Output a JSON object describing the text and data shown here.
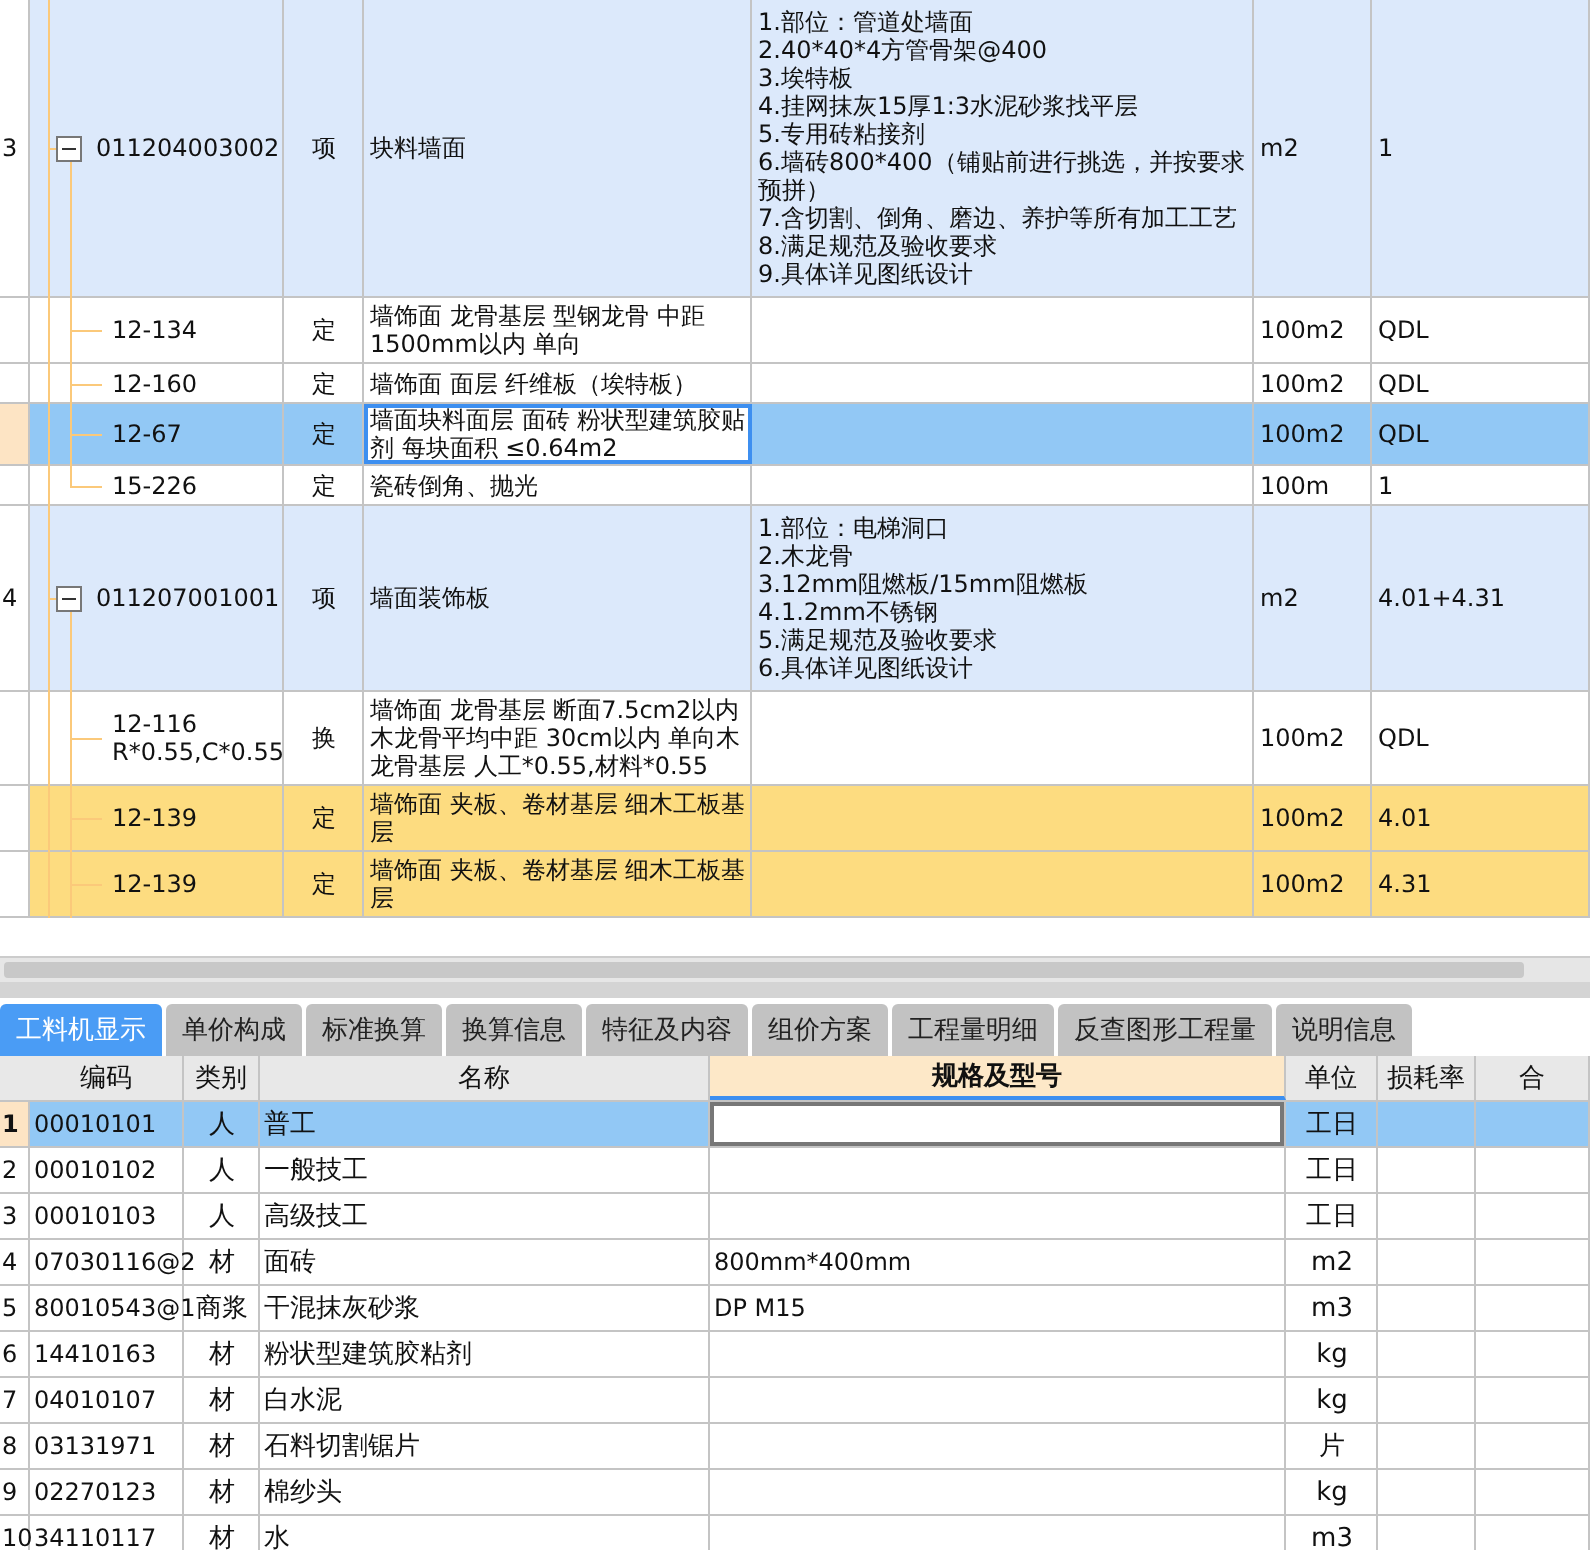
{
  "upper_table": {
    "rows": [
      {
        "row_number": "3",
        "code": "011204003002",
        "type": "项",
        "name": "块料墙面",
        "features": "1.部位：管道处墙面\n2.40*40*4方管骨架@400\n3.埃特板\n4.挂网抹灰15厚1:3水泥砂浆找平层\n5.专用砖粘接剂\n6.墙砖800*400（铺贴前进行挑选，并按要求预拼）\n7.含切割、倒角、磨边、养护等所有加工工艺\n8.满足规范及验收要求\n9.具体详见图纸设计",
        "unit": "m2",
        "quantity": "1",
        "expanded": true,
        "selected": false,
        "highlighted": false,
        "children": [
          {
            "code": "12-134",
            "type": "定",
            "name": "墙饰面 龙骨基层 型钢龙骨 中距1500mm以内 单向",
            "unit": "100m2",
            "quantity": "QDL",
            "selected": false,
            "highlighted": false
          },
          {
            "code": "12-160",
            "type": "定",
            "name": "墙饰面 面层 纤维板（埃特板）",
            "unit": "100m2",
            "quantity": "QDL",
            "selected": false,
            "highlighted": false
          },
          {
            "code": "12-67",
            "type": "定",
            "name": "墙面块料面层 面砖 粉状型建筑胶贴剂 每块面积 ≤0.64m2",
            "unit": "100m2",
            "quantity": "QDL",
            "selected": true,
            "highlighted": false
          },
          {
            "code": "15-226",
            "type": "定",
            "name": "瓷砖倒角、抛光",
            "unit": "100m",
            "quantity": "1",
            "selected": false,
            "highlighted": false
          }
        ]
      },
      {
        "row_number": "4",
        "code": "011207001001",
        "type": "项",
        "name": "墙面装饰板",
        "features": "1.部位：电梯洞口\n2.木龙骨\n3.12mm阻燃板/15mm阻燃板\n4.1.2mm不锈钢\n5.满足规范及验收要求\n6.具体详见图纸设计",
        "unit": "m2",
        "quantity": "4.01+4.31",
        "expanded": true,
        "selected": false,
        "highlighted": false,
        "children": [
          {
            "code": "12-116\nR*0.55,C*0.55",
            "type": "换",
            "name": "墙饰面 龙骨基层 断面7.5cm2以内木龙骨平均中距 30cm以内 单向木龙骨基层 人工*0.55,材料*0.55",
            "unit": "100m2",
            "quantity": "QDL",
            "selected": false,
            "highlighted": false
          },
          {
            "code": "12-139",
            "type": "定",
            "name": "墙饰面 夹板、卷材基层 细木工板基层",
            "unit": "100m2",
            "quantity": "4.01",
            "selected": false,
            "highlighted": true
          },
          {
            "code": "12-139",
            "type": "定",
            "name": "墙饰面 夹板、卷材基层 细木工板基层",
            "unit": "100m2",
            "quantity": "4.31",
            "selected": false,
            "highlighted": true
          }
        ]
      }
    ]
  },
  "tabs": [
    {
      "label": "工料机显示",
      "selected": true
    },
    {
      "label": "单价构成",
      "selected": false
    },
    {
      "label": "标准换算",
      "selected": false
    },
    {
      "label": "换算信息",
      "selected": false
    },
    {
      "label": "特征及内容",
      "selected": false
    },
    {
      "label": "组价方案",
      "selected": false
    },
    {
      "label": "工程量明细",
      "selected": false
    },
    {
      "label": "反查图形工程量",
      "selected": false
    },
    {
      "label": "说明信息",
      "selected": false
    }
  ],
  "lower_table": {
    "columns": [
      {
        "label": "编码",
        "active": false
      },
      {
        "label": "类别",
        "active": false
      },
      {
        "label": "名称",
        "active": false
      },
      {
        "label": "规格及型号",
        "active": true
      },
      {
        "label": "单位",
        "active": false
      },
      {
        "label": "损耗率",
        "active": false
      },
      {
        "label": "合",
        "active": false
      }
    ],
    "rows": [
      {
        "row_number": "1",
        "code": "00010101",
        "type": "人",
        "name": "普工",
        "unit": "工日",
        "selected": true
      },
      {
        "row_number": "2",
        "code": "00010102",
        "type": "人",
        "name": "一般技工",
        "unit": "工日",
        "selected": false
      },
      {
        "row_number": "3",
        "code": "00010103",
        "type": "人",
        "name": "高级技工",
        "unit": "工日",
        "selected": false
      },
      {
        "row_number": "4",
        "code": "07030116@2",
        "type": "材",
        "name": "面砖",
        "spec": "800mm*400mm",
        "unit": "m2",
        "selected": false
      },
      {
        "row_number": "5",
        "code": "80010543@1",
        "type": "商浆",
        "name": "干混抹灰砂浆",
        "spec": "DP M15",
        "unit": "m3",
        "selected": false
      },
      {
        "row_number": "6",
        "code": "14410163",
        "type": "材",
        "name": "粉状型建筑胶粘剂",
        "unit": "kg",
        "selected": false
      },
      {
        "row_number": "7",
        "code": "04010107",
        "type": "材",
        "name": "白水泥",
        "unit": "kg",
        "selected": false
      },
      {
        "row_number": "8",
        "code": "03131971",
        "type": "材",
        "name": "石料切割锯片",
        "unit": "片",
        "selected": false
      },
      {
        "row_number": "9",
        "code": "02270123",
        "type": "材",
        "name": "棉纱头",
        "unit": "kg",
        "selected": false
      },
      {
        "row_number": "10",
        "code": "34110117",
        "type": "材",
        "name": "水",
        "unit": "m3",
        "selected": false
      }
    ]
  }
}
